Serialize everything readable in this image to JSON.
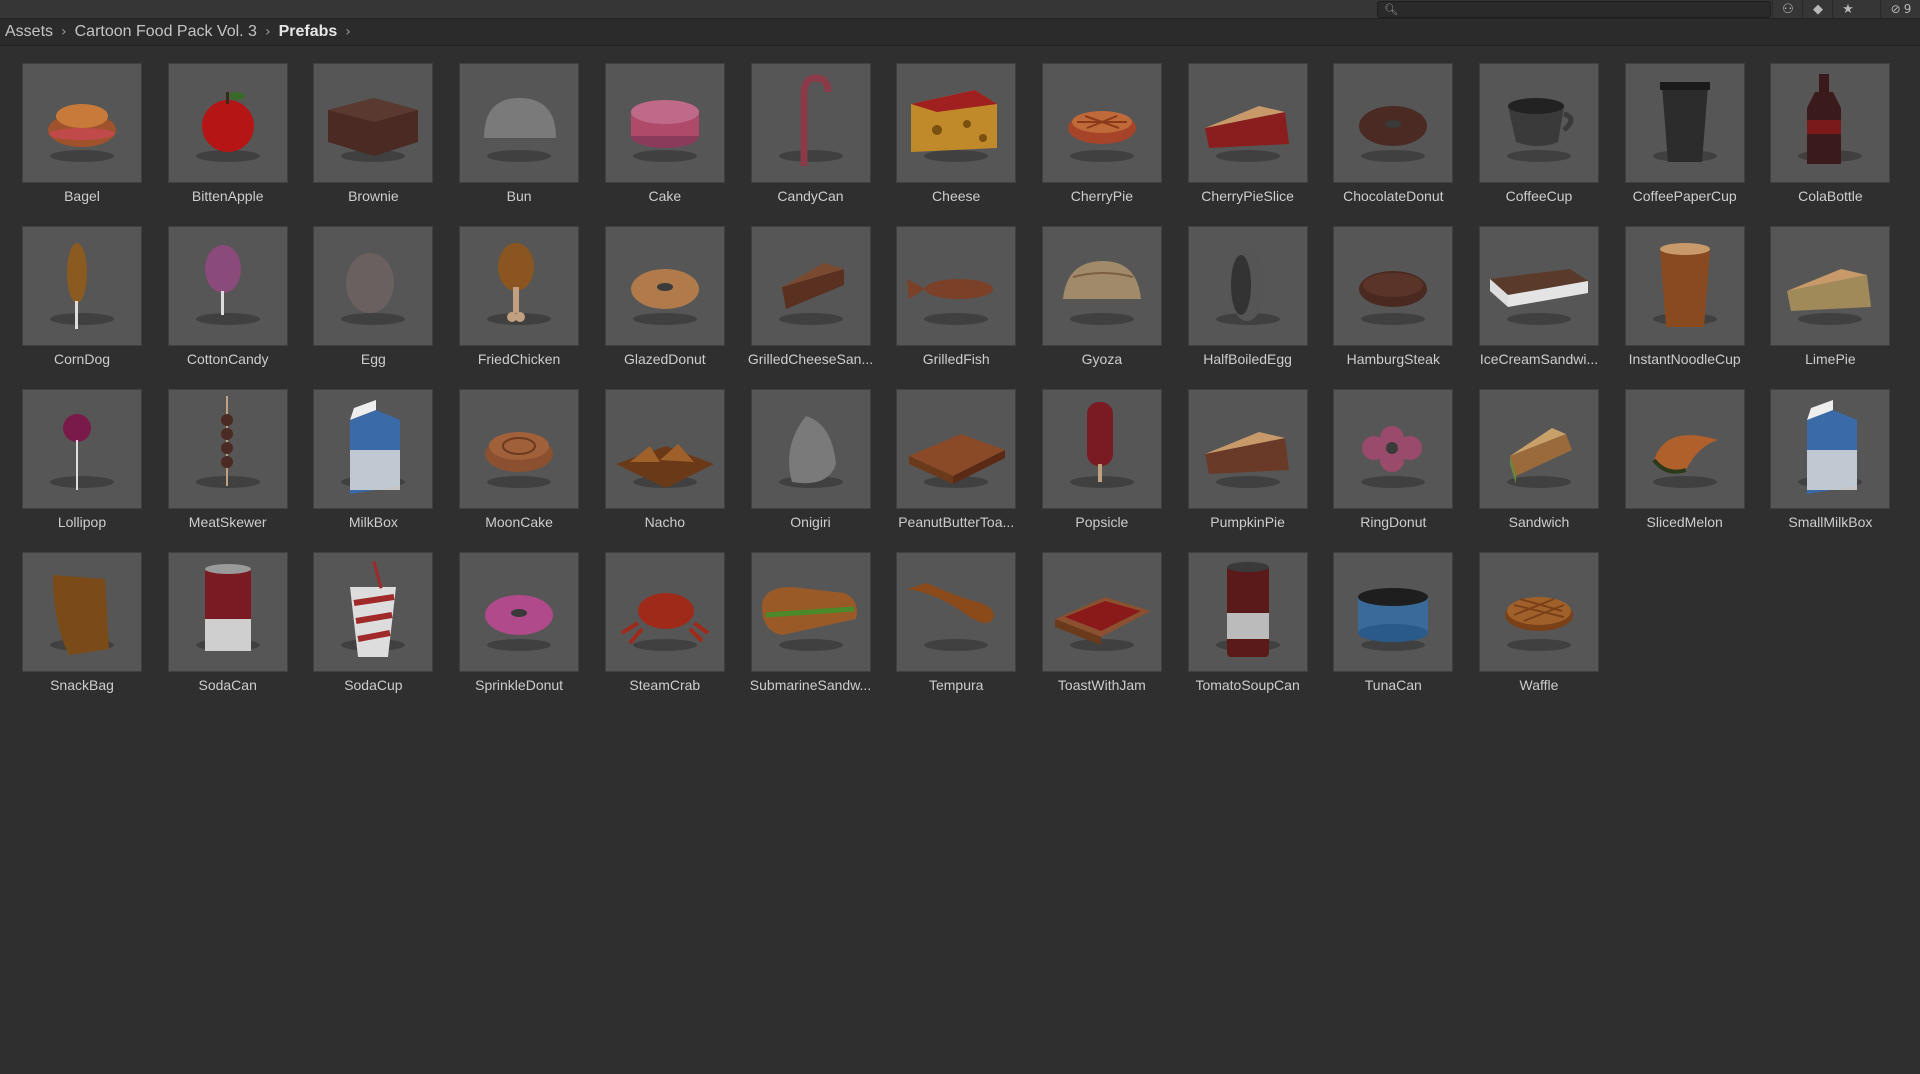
{
  "toolbar": {
    "search_placeholder": "",
    "buttons": [
      {
        "icon": "scene-filter-icon",
        "glyph": "⚇"
      },
      {
        "icon": "label-tag-icon",
        "glyph": "◆"
      },
      {
        "icon": "favorite-star-icon",
        "glyph": "★"
      }
    ],
    "hidden_packages_count": "9"
  },
  "breadcrumb": [
    {
      "label": "Assets"
    },
    {
      "label": "Cartoon Food Pack Vol. 3"
    },
    {
      "label": "Prefabs"
    }
  ],
  "assets": [
    {
      "label": "Bagel",
      "icon": "bagel",
      "color": "#a0522d"
    },
    {
      "label": "BittenApple",
      "icon": "apple",
      "color": "#b51515"
    },
    {
      "label": "Brownie",
      "icon": "block",
      "color": "#4a2a22"
    },
    {
      "label": "Bun",
      "icon": "dome",
      "color": "#7a7a7a"
    },
    {
      "label": "Cake",
      "icon": "cake",
      "color": "#b04a6a"
    },
    {
      "label": "CandyCan",
      "icon": "cane",
      "color": "#8b3a4a"
    },
    {
      "label": "Cheese",
      "icon": "cheese",
      "color": "#c08a2a"
    },
    {
      "label": "CherryPie",
      "icon": "pie",
      "color": "#a6442a"
    },
    {
      "label": "CherryPieSlice",
      "icon": "slice",
      "color": "#8a1e1e"
    },
    {
      "label": "ChocolateDonut",
      "icon": "donut",
      "color": "#4a2a22"
    },
    {
      "label": "CoffeeCup",
      "icon": "cup",
      "color": "#3a3a3a"
    },
    {
      "label": "CoffeePaperCup",
      "icon": "papercup",
      "color": "#2c2c2c"
    },
    {
      "label": "ColaBottle",
      "icon": "bottle",
      "color": "#3a1a1a"
    },
    {
      "label": "CornDog",
      "icon": "corndog",
      "color": "#8a5a20"
    },
    {
      "label": "CottonCandy",
      "icon": "cotton",
      "color": "#8a4a7a"
    },
    {
      "label": "Egg",
      "icon": "egg",
      "color": "#6a6060"
    },
    {
      "label": "FriedChicken",
      "icon": "drumstick",
      "color": "#8a5520"
    },
    {
      "label": "GlazedDonut",
      "icon": "donut",
      "color": "#b07a4a"
    },
    {
      "label": "GrilledCheeseSan...",
      "icon": "wedge",
      "color": "#5a3020"
    },
    {
      "label": "GrilledFish",
      "icon": "fish",
      "color": "#7a4028"
    },
    {
      "label": "Gyoza",
      "icon": "gyoza",
      "color": "#a08a6a"
    },
    {
      "label": "HalfBoiledEgg",
      "icon": "halfegg",
      "color": "#555555"
    },
    {
      "label": "HamburgSteak",
      "icon": "patty",
      "color": "#4a2a20"
    },
    {
      "label": "IceCreamSandwi...",
      "icon": "icecream",
      "color": "#5a3a2a"
    },
    {
      "label": "InstantNoodleCup",
      "icon": "noodlecup",
      "color": "#8a4a20"
    },
    {
      "label": "LimePie",
      "icon": "slice",
      "color": "#a08a5a"
    },
    {
      "label": "Lollipop",
      "icon": "lollipop",
      "color": "#7a1a4a"
    },
    {
      "label": "MeatSkewer",
      "icon": "skewer",
      "color": "#4a2a22"
    },
    {
      "label": "MilkBox",
      "icon": "milkbox",
      "color": "#3a6aa8"
    },
    {
      "label": "MoonCake",
      "icon": "mooncake",
      "color": "#8a5030"
    },
    {
      "label": "Nacho",
      "icon": "nacho",
      "color": "#a0602a"
    },
    {
      "label": "Onigiri",
      "icon": "onigiri",
      "color": "#7a7a7a"
    },
    {
      "label": "PeanutButterToa...",
      "icon": "toast",
      "color": "#8a4a28"
    },
    {
      "label": "Popsicle",
      "icon": "popsicle",
      "color": "#7a1a22"
    },
    {
      "label": "PumpkinPie",
      "icon": "slice",
      "color": "#6a3a28"
    },
    {
      "label": "RingDonut",
      "icon": "ringdonut",
      "color": "#9a4a6a"
    },
    {
      "label": "Sandwich",
      "icon": "sandwich",
      "color": "#9a6a3a"
    },
    {
      "label": "SlicedMelon",
      "icon": "melon",
      "color": "#b0602a"
    },
    {
      "label": "SmallMilkBox",
      "icon": "milkbox",
      "color": "#3a6aa8"
    },
    {
      "label": "SnackBag",
      "icon": "snackbag",
      "color": "#7a4a18"
    },
    {
      "label": "SodaCan",
      "icon": "can",
      "color": "#7a1a22"
    },
    {
      "label": "SodaCup",
      "icon": "sodacup",
      "color": "#a02a2a"
    },
    {
      "label": "SprinkleDonut",
      "icon": "donut",
      "color": "#b04a8a"
    },
    {
      "label": "SteamCrab",
      "icon": "crab",
      "color": "#a02a1a"
    },
    {
      "label": "SubmarineSandw...",
      "icon": "sub",
      "color": "#9a5a28"
    },
    {
      "label": "Tempura",
      "icon": "tempura",
      "color": "#8a4a1a"
    },
    {
      "label": "ToastWithJam",
      "icon": "toastjam",
      "color": "#8a1a1a"
    },
    {
      "label": "TomatoSoupCan",
      "icon": "soupcan",
      "color": "#5a1a1a"
    },
    {
      "label": "TunaCan",
      "icon": "tunacan",
      "color": "#3a6a9a"
    },
    {
      "label": "Waffle",
      "icon": "waffle",
      "color": "#a0602a"
    }
  ]
}
